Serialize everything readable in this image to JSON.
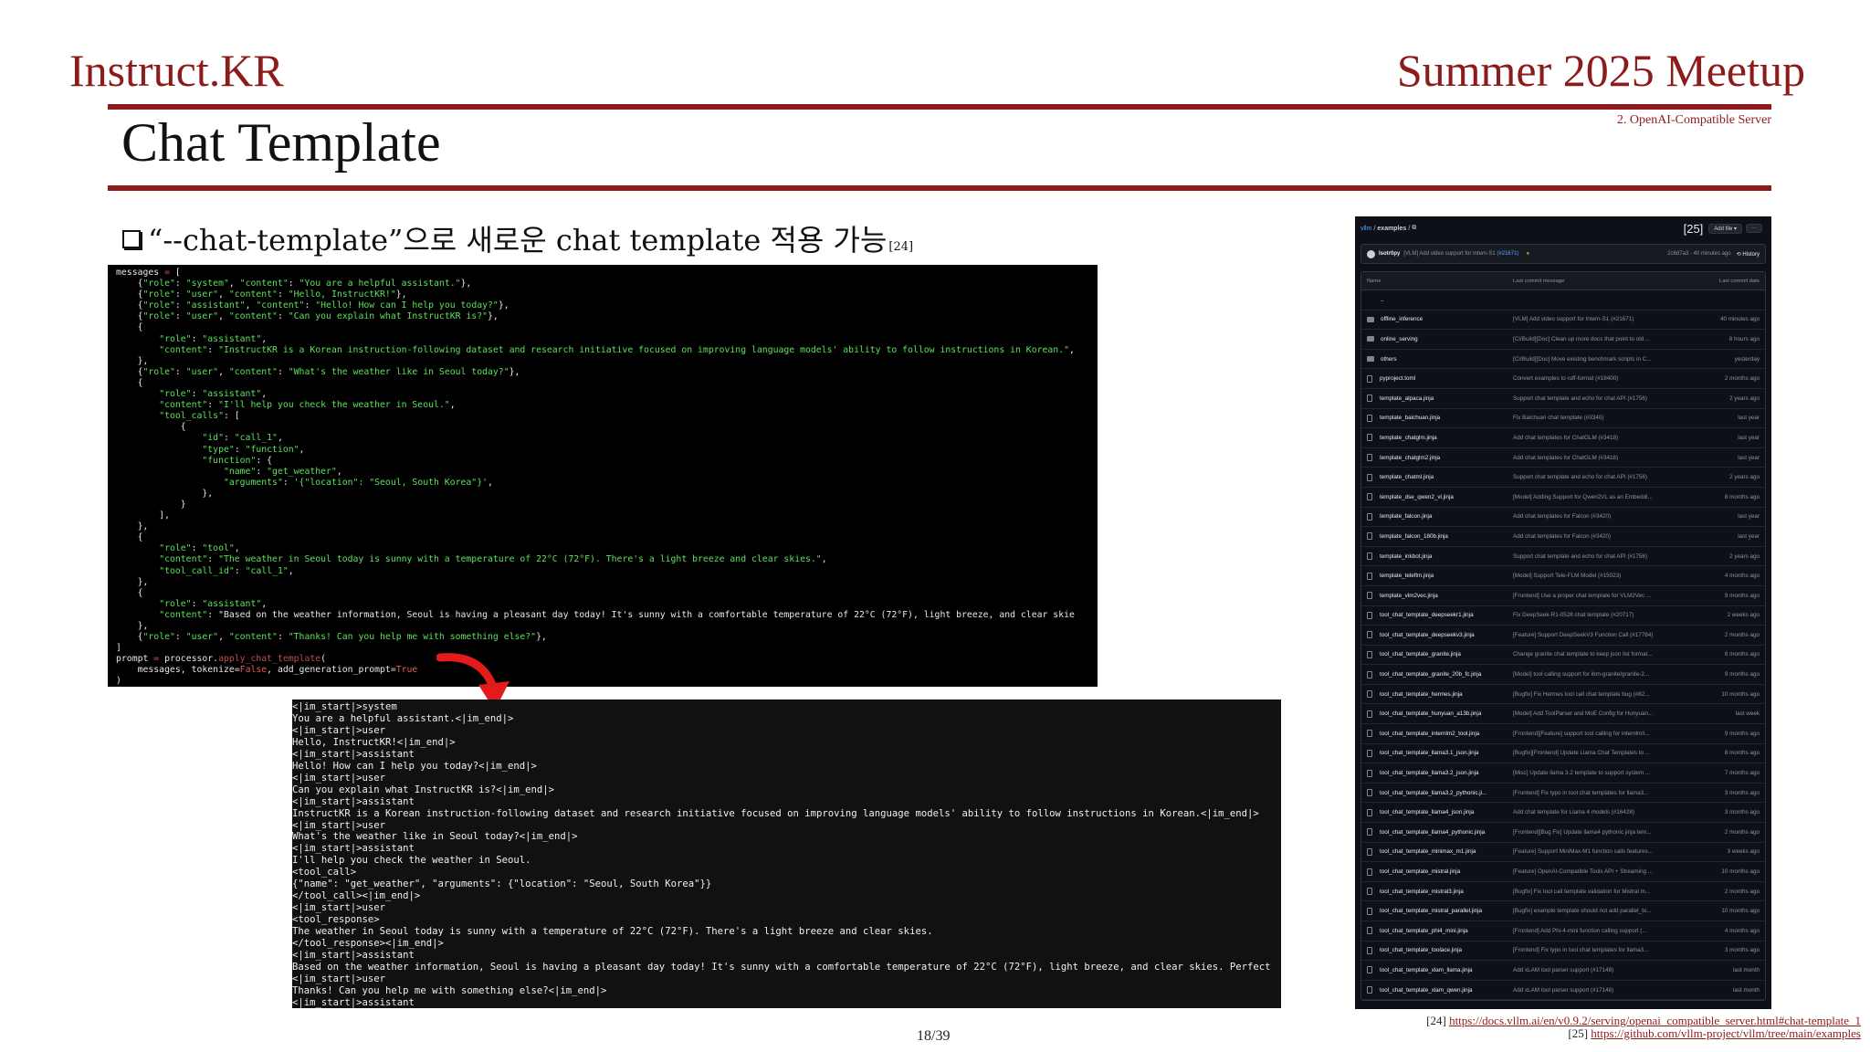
{
  "header": {
    "brand": "Instruct.KR",
    "event": "Summer 2025 Meetup",
    "section": "2. OpenAI-Compatible Server",
    "title": "Chat Template"
  },
  "bullet": {
    "text": "“--chat-template”으로 새로운 chat template 적용 가능",
    "ref": "[24]"
  },
  "code_input_lines": [
    "messages = [",
    "    {\"role\": \"system\", \"content\": \"You are a helpful assistant.\"},",
    "    {\"role\": \"user\", \"content\": \"Hello, InstructKR!\"},",
    "    {\"role\": \"assistant\", \"content\": \"Hello! How can I help you today?\"},",
    "    {\"role\": \"user\", \"content\": \"Can you explain what InstructKR is?\"},",
    "    {",
    "        \"role\": \"assistant\",",
    "        \"content\": \"InstructKR is a Korean instruction-following dataset and research initiative focused on improving language models' ability to follow instructions in Korean.\",",
    "    },",
    "    {\"role\": \"user\", \"content\": \"What's the weather like in Seoul today?\"},",
    "    {",
    "        \"role\": \"assistant\",",
    "        \"content\": \"I'll help you check the weather in Seoul.\",",
    "        \"tool_calls\": [",
    "            {",
    "                \"id\": \"call_1\",",
    "                \"type\": \"function\",",
    "                \"function\": {",
    "                    \"name\": \"get_weather\",",
    "                    \"arguments\": '{\"location\": \"Seoul, South Korea\"}',",
    "                },",
    "            }",
    "        ],",
    "    },",
    "    {",
    "        \"role\": \"tool\",",
    "        \"content\": \"The weather in Seoul today is sunny with a temperature of 22°C (72°F). There's a light breeze and clear skies.\",",
    "        \"tool_call_id\": \"call_1\",",
    "    },",
    "    {",
    "        \"role\": \"assistant\",",
    "        \"content\": \"Based on the weather information, Seoul is having a pleasant day today! It's sunny with a comfortable temperature of 22°C (72°F), light breeze, and clear skie",
    "    },",
    "    {\"role\": \"user\", \"content\": \"Thanks! Can you help me with something else?\"},",
    "]",
    "prompt = processor.apply_chat_template(",
    "    messages, tokenize=False, add_generation_prompt=True",
    ")"
  ],
  "code_output_lines": [
    "<|im_start|>system",
    "You are a helpful assistant.<|im_end|>",
    "<|im_start|>user",
    "Hello, InstructKR!<|im_end|>",
    "<|im_start|>assistant",
    "Hello! How can I help you today?<|im_end|>",
    "<|im_start|>user",
    "Can you explain what InstructKR is?<|im_end|>",
    "<|im_start|>assistant",
    "InstructKR is a Korean instruction-following dataset and research initiative focused on improving language models' ability to follow instructions in Korean.<|im_end|>",
    "<|im_start|>user",
    "What's the weather like in Seoul today?<|im_end|>",
    "<|im_start|>assistant",
    "I'll help you check the weather in Seoul.",
    "<tool_call>",
    "{\"name\": \"get_weather\", \"arguments\": {\"location\": \"Seoul, South Korea\"}}",
    "</tool_call><|im_end|>",
    "<|im_start|>user",
    "<tool_response>",
    "The weather in Seoul today is sunny with a temperature of 22°C (72°F). There's a light breeze and clear skies.",
    "</tool_response><|im_end|>",
    "<|im_start|>assistant",
    "Based on the weather information, Seoul is having a pleasant day today! It's sunny with a comfortable temperature of 22°C (72°F), light breeze, and clear skies. Perfect",
    "<|im_start|>user",
    "Thanks! Can you help me with something else?<|im_end|>",
    "<|im_start|>assistant"
  ],
  "github": {
    "repo": "vllm",
    "path": "examples",
    "ref_tag": "[25]",
    "add_file": "Add file",
    "commit": {
      "user": "Isotr0py",
      "message": "[VLM] Add video support for Intern-S1",
      "pr": "(#21671)",
      "meta": "2c6d7a3 · 40 minutes ago",
      "history": "History"
    },
    "columns": [
      "Name",
      "Last commit message",
      "Last commit date"
    ],
    "rows": [
      {
        "name": "..",
        "type": "parent",
        "message": "",
        "date": ""
      },
      {
        "name": "offline_inference",
        "type": "folder",
        "message": "[VLM] Add video support for Intern-S1 (#21671)",
        "date": "40 minutes ago"
      },
      {
        "name": "online_serving",
        "type": "folder",
        "message": "[CI/Build][Doc] Clean up more docs that point to old ...",
        "date": "8 hours ago"
      },
      {
        "name": "others",
        "type": "folder",
        "message": "[CI/Build][Doc] Move existing benchmark scripts in C...",
        "date": "yesterday"
      },
      {
        "name": "pyproject.toml",
        "type": "file",
        "message": "Convert examples to ruff-format (#18400)",
        "date": "2 months ago"
      },
      {
        "name": "template_alpaca.jinja",
        "type": "file",
        "message": "Support chat template and echo for chat API (#1756)",
        "date": "2 years ago"
      },
      {
        "name": "template_baichuan.jinja",
        "type": "file",
        "message": "Fix Baichuan chat template (#3340)",
        "date": "last year"
      },
      {
        "name": "template_chatglm.jinja",
        "type": "file",
        "message": "Add chat templates for ChatGLM (#3418)",
        "date": "last year"
      },
      {
        "name": "template_chatglm2.jinja",
        "type": "file",
        "message": "Add chat templates for ChatGLM (#3418)",
        "date": "last year"
      },
      {
        "name": "template_chatml.jinja",
        "type": "file",
        "message": "Support chat template and echo for chat API (#1756)",
        "date": "2 years ago"
      },
      {
        "name": "template_dse_qwen2_vl.jinja",
        "type": "file",
        "message": "[Model] Adding Support for Qwen2VL as an Embeddi...",
        "date": "8 months ago"
      },
      {
        "name": "template_falcon.jinja",
        "type": "file",
        "message": "Add chat templates for Falcon (#3420)",
        "date": "last year"
      },
      {
        "name": "template_falcon_180b.jinja",
        "type": "file",
        "message": "Add chat templates for Falcon (#3420)",
        "date": "last year"
      },
      {
        "name": "template_inkbot.jinja",
        "type": "file",
        "message": "Support chat template and echo for chat API (#1756)",
        "date": "2 years ago"
      },
      {
        "name": "template_teleflm.jinja",
        "type": "file",
        "message": "[Model] Support Tele-FLM Model (#15023)",
        "date": "4 months ago"
      },
      {
        "name": "template_vlm2vec.jinja",
        "type": "file",
        "message": "[Frontend] Use a proper chat template for VLM2Vec ...",
        "date": "9 months ago"
      },
      {
        "name": "tool_chat_template_deepseekr1.jinja",
        "type": "file",
        "message": "Fix DeepSeek-R1-0528 chat template (#20717)",
        "date": "2 weeks ago"
      },
      {
        "name": "tool_chat_template_deepseekv3.jinja",
        "type": "file",
        "message": "[Feature] Support DeepSeekV3 Function Call (#17784)",
        "date": "2 months ago"
      },
      {
        "name": "tool_chat_template_granite.jinja",
        "type": "file",
        "message": "Change granite chat template to keep json list format...",
        "date": "8 months ago"
      },
      {
        "name": "tool_chat_template_granite_20b_fc.jinja",
        "type": "file",
        "message": "[Model] tool calling support for ibm-granite/granite-2...",
        "date": "9 months ago"
      },
      {
        "name": "tool_chat_template_hermes.jinja",
        "type": "file",
        "message": "[Bugfix] Fix Hermes tool call chat template bug (#82...",
        "date": "10 months ago"
      },
      {
        "name": "tool_chat_template_hunyuan_a13b.jinja",
        "type": "file",
        "message": "[Model] Add ToolParser and MoE Config for Hunyuan...",
        "date": "last week"
      },
      {
        "name": "tool_chat_template_internlm2_tool.jinja",
        "type": "file",
        "message": "[Frontend][Feature] support tool calling for internlm/i...",
        "date": "9 months ago"
      },
      {
        "name": "tool_chat_template_llama3.1_json.jinja",
        "type": "file",
        "message": "[Bugfix][Frontend] Update Llama Chat Templates to ...",
        "date": "8 months ago"
      },
      {
        "name": "tool_chat_template_llama3.2_json.jinja",
        "type": "file",
        "message": "[Misc] Update llama 3.2 template to support system ...",
        "date": "7 months ago"
      },
      {
        "name": "tool_chat_template_llama3.2_pythonic.ji...",
        "type": "file",
        "message": "[Frontend] Fix typo in tool chat templates for llama3...",
        "date": "3 months ago"
      },
      {
        "name": "tool_chat_template_llama4_json.jinja",
        "type": "file",
        "message": "Add chat template for Llama 4 models (#16428)",
        "date": "3 months ago"
      },
      {
        "name": "tool_chat_template_llama4_pythonic.jinja",
        "type": "file",
        "message": "[Frontend][Bug Fix] Update llama4 pythonic jinja tem...",
        "date": "2 months ago"
      },
      {
        "name": "tool_chat_template_minimax_m1.jinja",
        "type": "file",
        "message": "[Feature] Support MiniMax-M1 function calls features...",
        "date": "3 weeks ago"
      },
      {
        "name": "tool_chat_template_mistral.jinja",
        "type": "file",
        "message": "[Feature] OpenAI-Compatible Tools API + Streaming ...",
        "date": "10 months ago"
      },
      {
        "name": "tool_chat_template_mistral3.jinja",
        "type": "file",
        "message": "[Bugfix] Fix tool call template validation for Mistral m...",
        "date": "2 months ago"
      },
      {
        "name": "tool_chat_template_mistral_parallel.jinja",
        "type": "file",
        "message": "[Bugfix] example template should not add parallel_to...",
        "date": "10 months ago"
      },
      {
        "name": "tool_chat_template_phi4_mini.jinja",
        "type": "file",
        "message": "[Frontend] Add Phi-4-mini function calling support (...",
        "date": "4 months ago"
      },
      {
        "name": "tool_chat_template_toolace.jinja",
        "type": "file",
        "message": "[Frontend] Fix typo in tool chat templates for llama3...",
        "date": "3 months ago"
      },
      {
        "name": "tool_chat_template_xlam_llama.jinja",
        "type": "file",
        "message": "Add xLAM tool parser support (#17148)",
        "date": "last month"
      },
      {
        "name": "tool_chat_template_xlam_qwen.jinja",
        "type": "file",
        "message": "Add xLAM tool parser support (#17148)",
        "date": "last month"
      }
    ]
  },
  "footnotes": [
    {
      "label": "[24]",
      "url": "https://docs.vllm.ai/en/v0.9.2/serving/openai_compatible_server.html#chat-template_1"
    },
    {
      "label": "[25]",
      "url": "https://github.com/vllm-project/vllm/tree/main/examples"
    }
  ],
  "page": "18/39",
  "colors": {
    "accent": "#8c1c1c",
    "code_string": "#5de05d",
    "code_keyword": "#e05a5a",
    "github_bg": "#0d1117",
    "github_link": "#58a6ff"
  }
}
